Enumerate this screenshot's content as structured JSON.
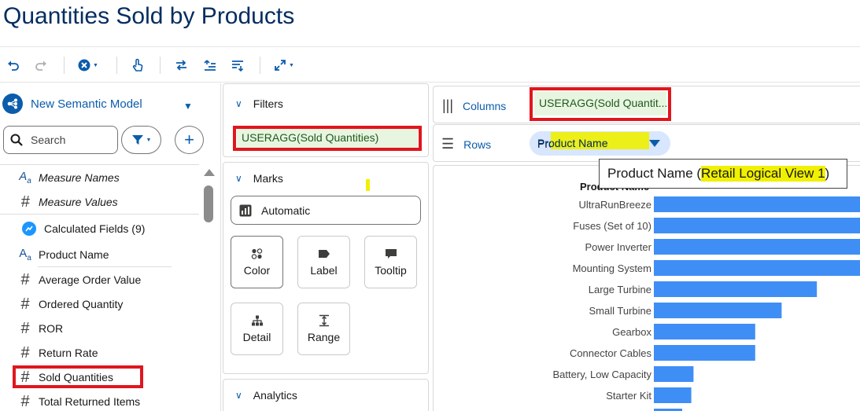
{
  "page": {
    "title": "Quantities Sold by Products"
  },
  "toolbar": {
    "icons": [
      "undo-icon",
      "redo-icon",
      "clear-icon",
      "touch-icon",
      "swap-icon",
      "sort-ascending-icon",
      "sort-descending-icon",
      "fit-icon"
    ]
  },
  "data_panel": {
    "model_name": "New Semantic Model",
    "search_placeholder": "Search",
    "fields": [
      {
        "icon": "Aa",
        "label": "Measure Names",
        "italic": true
      },
      {
        "icon": "#",
        "label": "Measure Values",
        "italic": true
      },
      {
        "icon": "calc",
        "label": "Calculated Fields (9)"
      },
      {
        "icon": "Aa",
        "label": "Product Name"
      },
      {
        "icon": "#",
        "label": "Average Order Value"
      },
      {
        "icon": "#",
        "label": "Ordered Quantity"
      },
      {
        "icon": "#",
        "label": "ROR"
      },
      {
        "icon": "#",
        "label": "Return Rate"
      },
      {
        "icon": "#",
        "label": "Sold Quantities"
      },
      {
        "icon": "#",
        "label": "Total Returned Items"
      }
    ]
  },
  "filters": {
    "title": "Filters",
    "pill": "USERAGG(Sold Quantities)"
  },
  "marks": {
    "title": "Marks",
    "type": "Automatic",
    "buttons": [
      "Color",
      "Label",
      "Tooltip",
      "Detail",
      "Range"
    ]
  },
  "analytics": {
    "title": "Analytics"
  },
  "shelves": {
    "columns_label": "Columns",
    "columns_pill": "USERAGG(Sold Quantit...",
    "rows_label": "Rows",
    "rows_pill": "Product Name"
  },
  "tooltip": {
    "prefix": "Product Name (",
    "highlight": "Retail Logical View 1",
    "suffix": ")"
  },
  "colors": {
    "accent": "#0b5cab",
    "bar": "#3f8ef5",
    "annotation_red": "#e0161e",
    "highlight_yellow": "#f0f000"
  },
  "chart_data": {
    "type": "bar",
    "orientation": "horizontal",
    "ylabel": "Product Name",
    "categories": [
      "UltraRunBreeze",
      "Fuses (Set of 10)",
      "Power Inverter",
      "Mounting System",
      "Large Turbine",
      "Small Turbine",
      "Gearbox",
      "Connector Cables",
      "Battery, Low Capacity",
      "Starter Kit"
    ],
    "values": [
      100,
      100,
      100,
      98,
      74,
      58,
      46,
      46,
      18,
      17
    ],
    "xlim": [
      0,
      100
    ]
  }
}
